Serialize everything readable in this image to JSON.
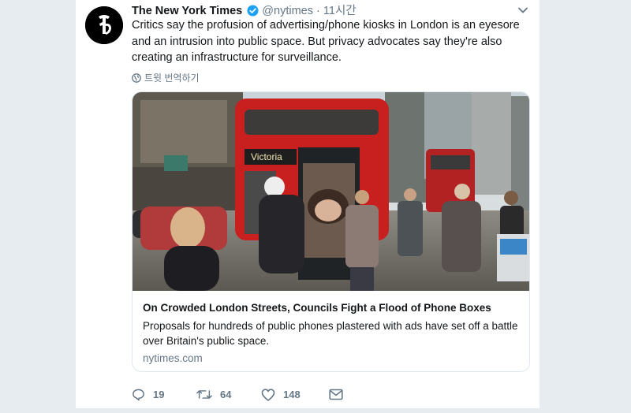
{
  "tweet": {
    "author_name": "The New York Times",
    "handle": "@nytimes",
    "separator": "·",
    "time": "11시간",
    "text": "Critics say the profusion of advertising/phone kiosks in London is an eyesore and an intrusion into public space. But privacy advocates say they're also creating an infrastructure for surveillance.",
    "translate_label": "트윗 번역하기"
  },
  "card": {
    "title": "On Crowded London Streets, Councils Fight a Flood of Phone Boxes",
    "description": "Proposals for hundreds of public phones plastered with ads have set off a battle over Britain's public space.",
    "domain": "nytimes.com",
    "bus_destination": "Victoria"
  },
  "actions": {
    "replies": "19",
    "retweets": "64",
    "likes": "148"
  },
  "icons": [
    "nyt-logo-icon",
    "verified-badge-icon",
    "chevron-down-icon",
    "globe-icon",
    "reply-icon",
    "retweet-icon",
    "like-icon",
    "direct-message-icon"
  ],
  "colors": {
    "accent": "#1da1f2",
    "muted": "#657786",
    "background": "#e6ecf0"
  }
}
